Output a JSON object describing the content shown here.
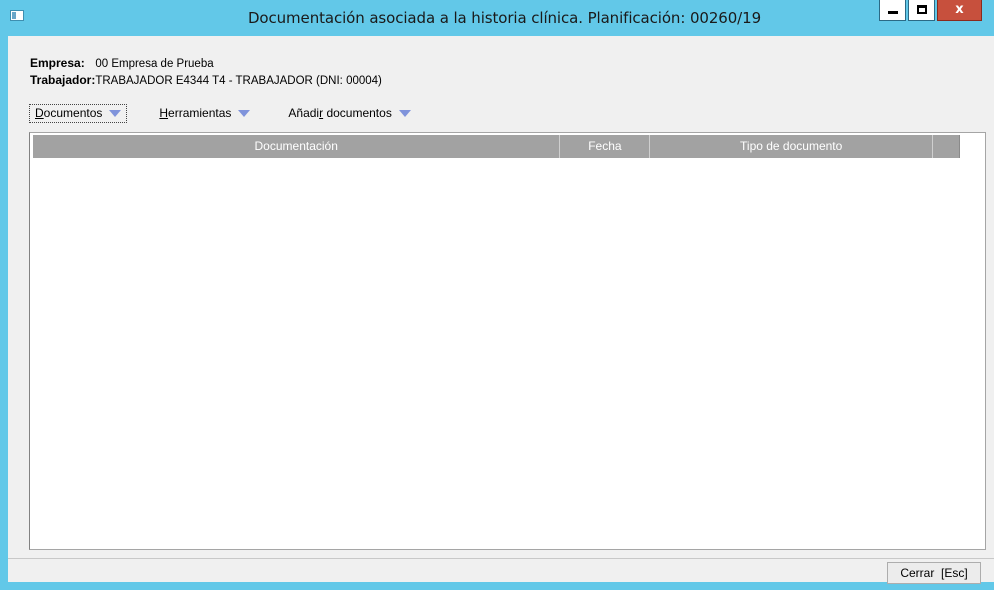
{
  "window": {
    "title": "Documentación asociada a la historia clínica. Planificación: 00260/19",
    "close_glyph": "x",
    "accent_color": "#62c8e8",
    "close_color": "#c7503d"
  },
  "info": {
    "empresa_label": "Empresa:",
    "empresa_value": "00 Empresa de Prueba",
    "trabajador_label": "Trabajador:",
    "trabajador_value": "TRABAJADOR E4344 T4 - TRABAJADOR  (DNI: 00004)"
  },
  "toolbar": {
    "documentos": {
      "accel": "D",
      "rest": "ocumentos"
    },
    "herramientas": {
      "accel": "H",
      "rest": "erramientas"
    },
    "anadir": {
      "pre": "Añadi",
      "accel": "r",
      "post": " documentos"
    },
    "dropdown_icon": "triangle-down-icon"
  },
  "grid": {
    "columns": [
      "Documentación",
      "Fecha",
      "Tipo de documento",
      ""
    ],
    "rows": []
  },
  "footer": {
    "close_label": "Cerrar  [Esc]"
  }
}
